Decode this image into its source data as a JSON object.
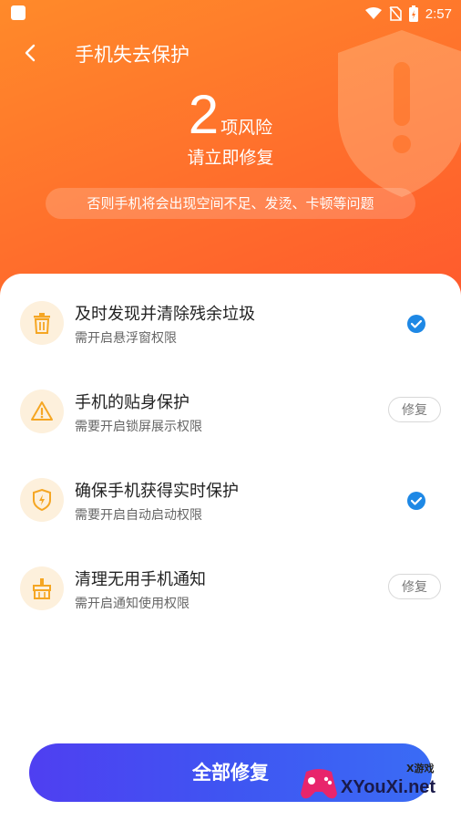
{
  "status_bar": {
    "time": "2:57"
  },
  "header": {
    "title": "手机失去保护",
    "risk_count": "2",
    "risk_label": "项风险",
    "risk_sub": "请立即修复",
    "warning": "否则手机将会出现空间不足、发烫、卡顿等问题"
  },
  "items": [
    {
      "icon": "trash-icon",
      "title": "及时发现并清除残余垃圾",
      "desc": "需开启悬浮窗权限",
      "status": "done"
    },
    {
      "icon": "warning-icon",
      "title": "手机的贴身保护",
      "desc": "需要开启锁屏展示权限",
      "status": "fix",
      "button": "修复"
    },
    {
      "icon": "shield-bolt-icon",
      "title": "确保手机获得实时保护",
      "desc": "需要开启自动启动权限",
      "status": "done"
    },
    {
      "icon": "broom-icon",
      "title": "清理无用手机通知",
      "desc": "需开启通知使用权限",
      "status": "fix",
      "button": "修复"
    }
  ],
  "fix_all_label": "全部修复",
  "watermark": {
    "text": "XYouXi.net",
    "small": "X游戏"
  },
  "colors": {
    "header_orange": "#ff7a2c",
    "accent_blue": "#1e88e5",
    "button_purple": "#4f3ff1",
    "icon_bg": "#fdf0dc"
  }
}
